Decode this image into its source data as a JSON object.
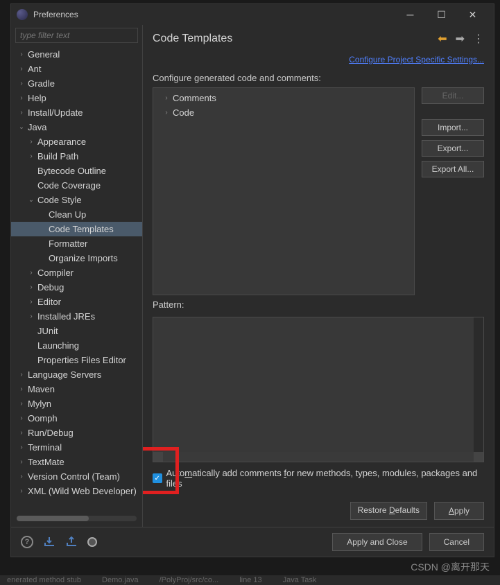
{
  "titlebar": {
    "title": "Preferences"
  },
  "filter": {
    "placeholder": "type filter text"
  },
  "tree": [
    {
      "label": "General",
      "expand": "›",
      "indent": 0
    },
    {
      "label": "Ant",
      "expand": "›",
      "indent": 0
    },
    {
      "label": "Gradle",
      "expand": "›",
      "indent": 0
    },
    {
      "label": "Help",
      "expand": "›",
      "indent": 0
    },
    {
      "label": "Install/Update",
      "expand": "›",
      "indent": 0
    },
    {
      "label": "Java",
      "expand": "⌄",
      "indent": 0
    },
    {
      "label": "Appearance",
      "expand": "›",
      "indent": 1
    },
    {
      "label": "Build Path",
      "expand": "›",
      "indent": 1
    },
    {
      "label": "Bytecode Outline",
      "expand": "",
      "indent": 1
    },
    {
      "label": "Code Coverage",
      "expand": "",
      "indent": 1
    },
    {
      "label": "Code Style",
      "expand": "⌄",
      "indent": 1
    },
    {
      "label": "Clean Up",
      "expand": "",
      "indent": 2
    },
    {
      "label": "Code Templates",
      "expand": "",
      "indent": 2,
      "selected": true
    },
    {
      "label": "Formatter",
      "expand": "",
      "indent": 2
    },
    {
      "label": "Organize Imports",
      "expand": "",
      "indent": 2
    },
    {
      "label": "Compiler",
      "expand": "›",
      "indent": 1
    },
    {
      "label": "Debug",
      "expand": "›",
      "indent": 1
    },
    {
      "label": "Editor",
      "expand": "›",
      "indent": 1
    },
    {
      "label": "Installed JREs",
      "expand": "›",
      "indent": 1
    },
    {
      "label": "JUnit",
      "expand": "",
      "indent": 1
    },
    {
      "label": "Launching",
      "expand": "",
      "indent": 1
    },
    {
      "label": "Properties Files Editor",
      "expand": "",
      "indent": 1
    },
    {
      "label": "Language Servers",
      "expand": "›",
      "indent": 0
    },
    {
      "label": "Maven",
      "expand": "›",
      "indent": 0
    },
    {
      "label": "Mylyn",
      "expand": "›",
      "indent": 0
    },
    {
      "label": "Oomph",
      "expand": "›",
      "indent": 0
    },
    {
      "label": "Run/Debug",
      "expand": "›",
      "indent": 0
    },
    {
      "label": "Terminal",
      "expand": "›",
      "indent": 0
    },
    {
      "label": "TextMate",
      "expand": "›",
      "indent": 0
    },
    {
      "label": "Version Control (Team)",
      "expand": "›",
      "indent": 0
    },
    {
      "label": "XML (Wild Web Developer)",
      "expand": "›",
      "indent": 0
    }
  ],
  "main": {
    "title": "Code Templates",
    "link": "Configure Project Specific Settings...",
    "section1": "Configure generated code and comments:",
    "configTree": [
      {
        "label": "Comments",
        "expand": "›"
      },
      {
        "label": "Code",
        "expand": "›"
      }
    ],
    "buttons": {
      "edit": "Edit...",
      "import": "Import...",
      "export": "Export...",
      "exportAll": "Export All..."
    },
    "patternLabel": "Pattern:",
    "checkboxLabel_pre": "Auto",
    "checkboxLabel_u": "m",
    "checkboxLabel_mid": "atically add comments ",
    "checkboxLabel_u2": "f",
    "checkboxLabel_post": "or new methods, types, modules, packages and files",
    "restore_pre": "Restore ",
    "restore_u": "D",
    "restore_post": "efaults",
    "apply_u": "A",
    "apply_post": "pply"
  },
  "footer": {
    "applyClose": "Apply and Close",
    "cancel": "Cancel"
  },
  "watermark": "CSDN @离开那天",
  "bgstrip": [
    "enerated method stub",
    "Demo.java",
    "/PolyProj/src/co...",
    "line 13",
    "Java Task"
  ]
}
